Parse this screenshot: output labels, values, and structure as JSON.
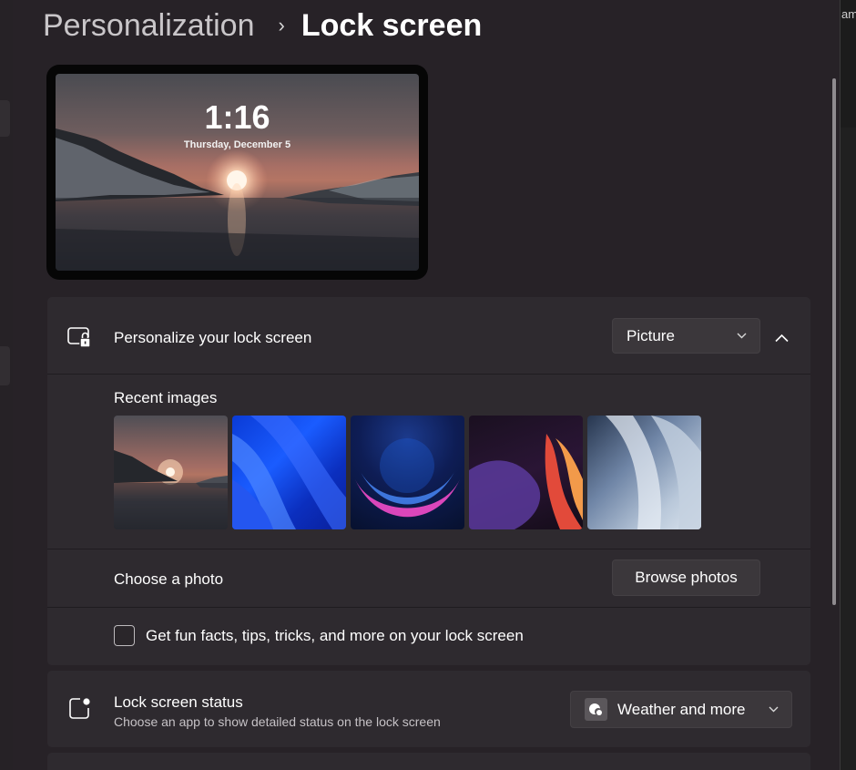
{
  "breadcrumb": {
    "parent": "Personalization",
    "separator": "›",
    "current": "Lock screen"
  },
  "preview": {
    "time": "1:16",
    "date": "Thursday, December 5"
  },
  "personalize": {
    "label": "Personalize your lock screen",
    "dropdown_value": "Picture",
    "recent_images_label": "Recent images",
    "recent_images": [
      "Sunset lake",
      "Blue bloom",
      "Glow",
      "Flow",
      "Bloom light"
    ],
    "choose_photo_label": "Choose a photo",
    "browse_button": "Browse photos",
    "fun_facts_label": "Get fun facts, tips, tricks, and more on your lock screen",
    "fun_facts_checked": false
  },
  "status": {
    "label": "Lock screen status",
    "description": "Choose an app to show detailed status on the lock screen",
    "dropdown_value": "Weather and more"
  },
  "right_rail_text": "am"
}
